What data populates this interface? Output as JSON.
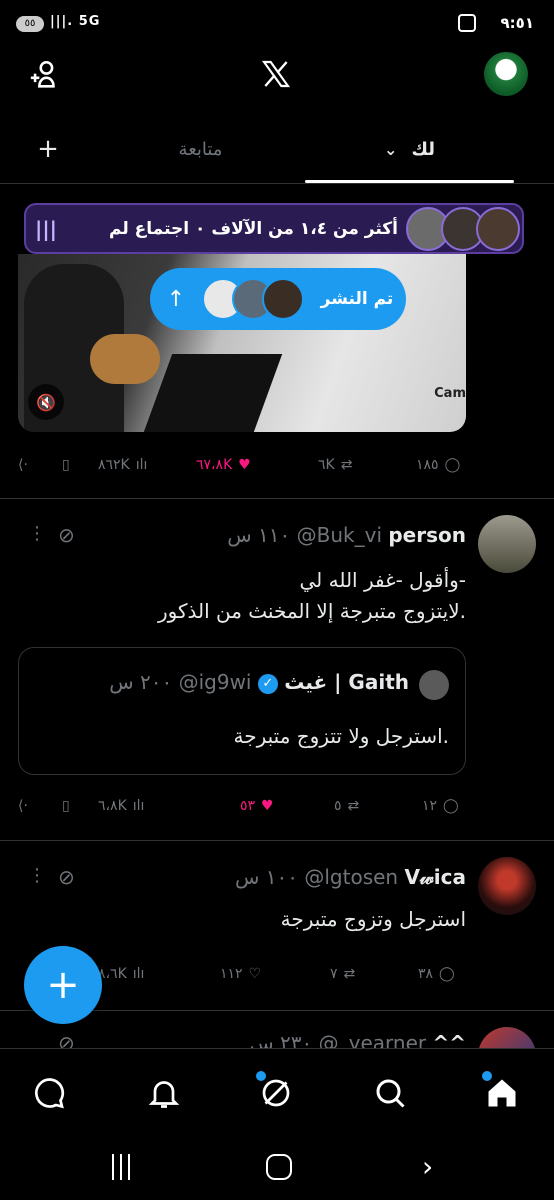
{
  "status": {
    "time": "٩:٥١",
    "battery": "٥٥",
    "network": "5G"
  },
  "tabs": {
    "for_you": "لك",
    "following": "متابعة"
  },
  "space": {
    "text": "أكثر من ١،٤ من الآلاف ٠ اجتماع لم"
  },
  "posted_pill": {
    "label": "تم النشر"
  },
  "tweet1": {
    "video_label": "Cam",
    "replies": "١٨٥",
    "retweets": "٦K",
    "likes": "٦٧،٨K",
    "views": "٨٦٢K"
  },
  "tweet2": {
    "name": "person",
    "handle": "@Buk_vi",
    "time": "١١٠ س",
    "text_line1": "وأقول -غفر الله لي-",
    "text_line2": "لايتزوج متبرجة إلا المخنث من الذكور.",
    "quote": {
      "name": "غيث | Gaith",
      "handle": "@ig9wi",
      "time": "٢٠٠ س",
      "text": "استرجل ولا تتزوج متبرجة."
    },
    "replies": "١٢",
    "retweets": "٥",
    "likes": "٥٣",
    "views": "٦،٨K"
  },
  "tweet3": {
    "name": "V𝓌ica",
    "handle": "@lgtosen",
    "time": "١٠٠ س",
    "text": "استرجل وتزوج متبرجة",
    "replies": "٣٨",
    "retweets": "٧",
    "likes": "١١٢",
    "views": "٨،٦K"
  },
  "tweet4": {
    "name": "^^",
    "handle": "@_yearner",
    "time": "٢٣٠ س"
  },
  "colors": {
    "accent": "#1d9bf0",
    "like": "#f91880",
    "space_bg": "#2a1c52"
  }
}
